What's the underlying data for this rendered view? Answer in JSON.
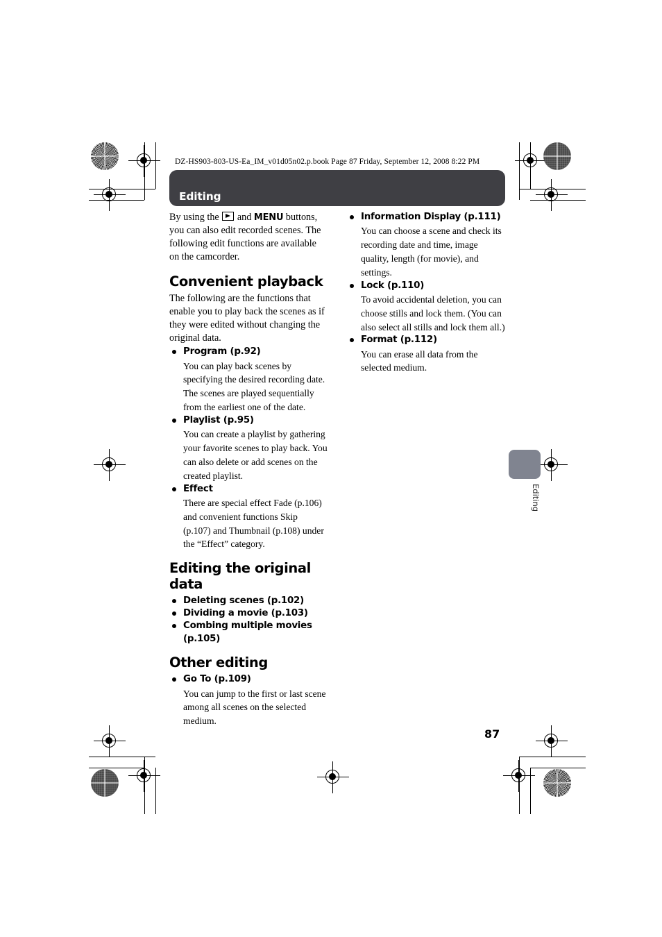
{
  "print_meta": {
    "header_line": "DZ-HS903-803-US-Ea_IM_v01d05n02.p.book  Page 87  Friday, September 12, 2008  8:22 PM"
  },
  "section_bar": {
    "title": "Editing"
  },
  "intro": {
    "before_icon": "By using the",
    "icon": "play-button-icon",
    "and": "and",
    "menu": "MENU",
    "after": "buttons, you can also edit recorded scenes. The following edit functions are available on the camcorder."
  },
  "left_column": {
    "sections": [
      {
        "heading": "Convenient playback",
        "intro": "The following are the functions that enable you to play back the scenes as if they were edited without changing the original data.",
        "bullets": [
          {
            "title": "Program (p.92)",
            "desc": "You can play back scenes by specifying the desired recording date. The scenes are played sequentially from the earliest one of the date."
          },
          {
            "title": "Playlist (p.95)",
            "desc": "You can create a playlist by gathering your favorite scenes to play back. You can also delete or add scenes on the created playlist."
          },
          {
            "title": "Effect",
            "desc": "There are special effect Fade (p.106) and convenient functions Skip (p.107) and Thumbnail (p.108) under the “Effect” category."
          }
        ]
      },
      {
        "heading": "Editing the original data",
        "intro": "",
        "bullets": [
          {
            "title": "Deleting scenes (p.102)",
            "desc": ""
          },
          {
            "title": "Dividing a movie (p.103)",
            "desc": ""
          },
          {
            "title": "Combing multiple movies (p.105)",
            "desc": ""
          }
        ]
      },
      {
        "heading": "Other editing",
        "intro": "",
        "bullets": [
          {
            "title": "Go To (p.109)",
            "desc": "You can jump to the first or last scene among all scenes on the selected medium."
          }
        ]
      }
    ]
  },
  "right_column": {
    "bullets": [
      {
        "title": "Information Display (p.111)",
        "desc": "You can choose a scene and check its recording date and time, image quality, length (for movie), and settings."
      },
      {
        "title": "Lock (p.110)",
        "desc": "To avoid accidental deletion, you can choose stills and lock them. (You can also select all stills and lock them all.)"
      },
      {
        "title": "Format (p.112)",
        "desc": "You can erase all data from the selected medium."
      }
    ]
  },
  "side_tab": {
    "label": "Editing"
  },
  "footer": {
    "page_number": "87"
  },
  "colors": {
    "section_bar": "#3f3f44",
    "side_tab": "#808490",
    "text": "#000000"
  }
}
